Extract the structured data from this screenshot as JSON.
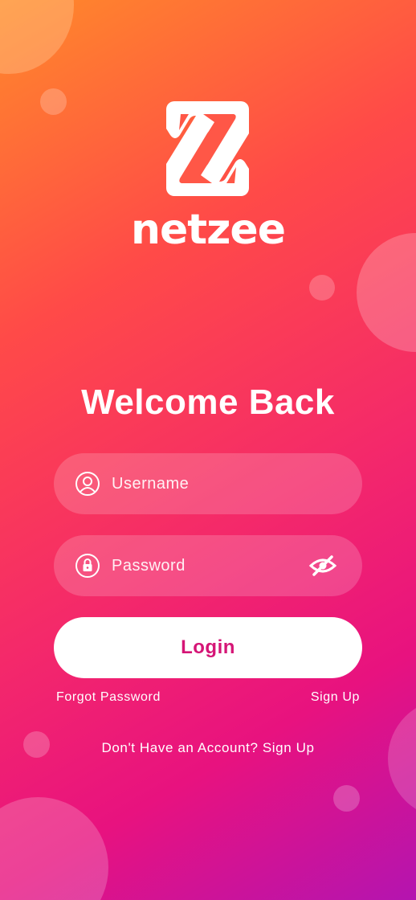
{
  "brand": {
    "name": "netzee",
    "logo_icon": "netzee-z-logo-icon"
  },
  "heading": "Welcome Back",
  "form": {
    "username": {
      "placeholder": "Username",
      "value": "",
      "icon": "user-circle-icon"
    },
    "password": {
      "placeholder": "Password",
      "value": "",
      "icon": "lock-icon",
      "toggle_icon": "eye-slash-icon"
    },
    "login_label": "Login"
  },
  "links": {
    "forgot_password": "Forgot Password",
    "sign_up": "Sign Up",
    "no_account_text": "Don't Have an Account? Sign Up"
  },
  "colors": {
    "gradient_start": "#ff8a2a",
    "gradient_mid": "#f4296a",
    "gradient_end": "#b414b0",
    "login_text": "#d51576"
  }
}
